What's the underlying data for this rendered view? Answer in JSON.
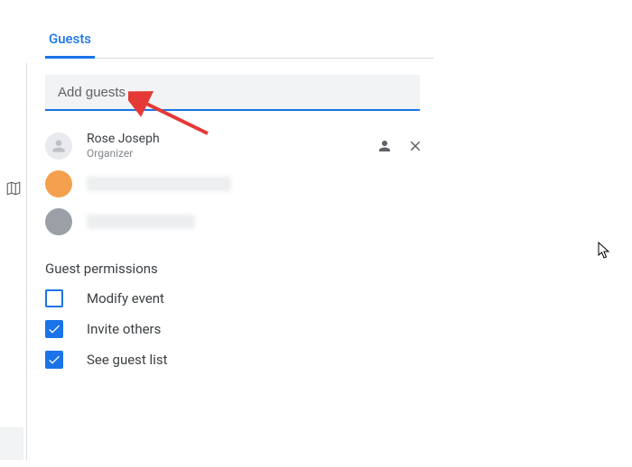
{
  "tab_label": "Guests",
  "input_placeholder": "Add guests",
  "guests": {
    "organizer": {
      "name": "Rose Joseph",
      "role": "Organizer"
    }
  },
  "permissions": {
    "title": "Guest permissions",
    "modify": {
      "label": "Modify event",
      "checked": false
    },
    "invite": {
      "label": "Invite others",
      "checked": true
    },
    "seelist": {
      "label": "See guest list",
      "checked": true
    }
  },
  "colors": {
    "accent": "#1a73e8"
  }
}
